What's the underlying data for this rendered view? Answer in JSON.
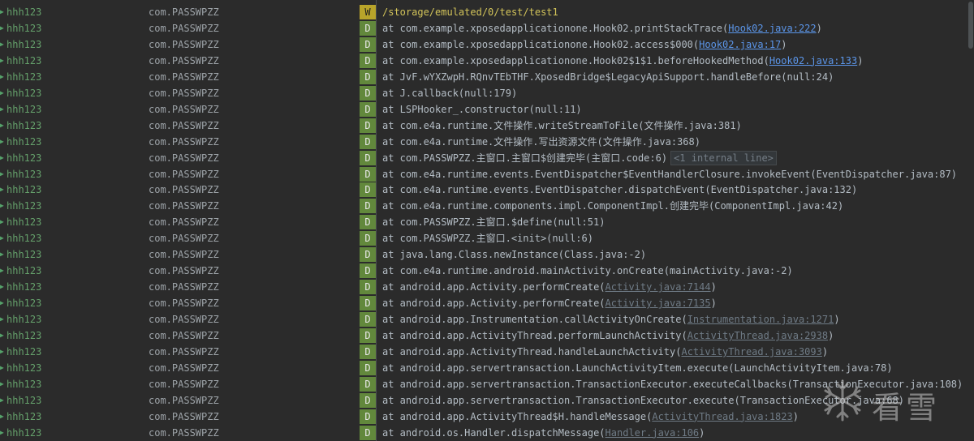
{
  "logcat": {
    "rows": [
      {
        "tag": "hhh123",
        "pkg": "com.PASSWPZZ",
        "level": "W",
        "parts": [
          {
            "t": "/storage/emulated/0/test/test1"
          }
        ]
      },
      {
        "tag": "hhh123",
        "pkg": "com.PASSWPZZ",
        "level": "D",
        "parts": [
          {
            "t": "at com.example.xposedapplicationone.Hook02.printStackTrace("
          },
          {
            "t": "Hook02.java:222",
            "link": "blue"
          },
          {
            "t": ")"
          }
        ]
      },
      {
        "tag": "hhh123",
        "pkg": "com.PASSWPZZ",
        "level": "D",
        "parts": [
          {
            "t": "at com.example.xposedapplicationone.Hook02.access$000("
          },
          {
            "t": "Hook02.java:17",
            "link": "blue"
          },
          {
            "t": ")"
          }
        ]
      },
      {
        "tag": "hhh123",
        "pkg": "com.PASSWPZZ",
        "level": "D",
        "parts": [
          {
            "t": "at com.example.xposedapplicationone.Hook02$1$1.beforeHookedMethod("
          },
          {
            "t": "Hook02.java:133",
            "link": "blue"
          },
          {
            "t": ")"
          }
        ]
      },
      {
        "tag": "hhh123",
        "pkg": "com.PASSWPZZ",
        "level": "D",
        "parts": [
          {
            "t": "at JvF.wYXZwpH.RQnvTEbTHF.XposedBridge$LegacyApiSupport.handleBefore(null:24)"
          }
        ]
      },
      {
        "tag": "hhh123",
        "pkg": "com.PASSWPZZ",
        "level": "D",
        "parts": [
          {
            "t": "at J.callback(null:179)"
          }
        ]
      },
      {
        "tag": "hhh123",
        "pkg": "com.PASSWPZZ",
        "level": "D",
        "parts": [
          {
            "t": "at LSPHooker_.constructor(null:11)"
          }
        ]
      },
      {
        "tag": "hhh123",
        "pkg": "com.PASSWPZZ",
        "level": "D",
        "parts": [
          {
            "t": "at com.e4a.runtime.文件操作.writeStreamToFile(文件操作.java:381)"
          }
        ]
      },
      {
        "tag": "hhh123",
        "pkg": "com.PASSWPZZ",
        "level": "D",
        "parts": [
          {
            "t": "at com.e4a.runtime.文件操作.写出资源文件(文件操作.java:368)"
          }
        ]
      },
      {
        "tag": "hhh123",
        "pkg": "com.PASSWPZZ",
        "level": "D",
        "parts": [
          {
            "t": "at com.PASSWPZZ.主窗口.主窗口$创建完毕(主窗口.code:6)"
          },
          {
            "t": "<1 internal line>",
            "fold": true
          }
        ]
      },
      {
        "tag": "hhh123",
        "pkg": "com.PASSWPZZ",
        "level": "D",
        "parts": [
          {
            "t": "at com.e4a.runtime.events.EventDispatcher$EventHandlerClosure.invokeEvent(EventDispatcher.java:87)"
          }
        ]
      },
      {
        "tag": "hhh123",
        "pkg": "com.PASSWPZZ",
        "level": "D",
        "parts": [
          {
            "t": "at com.e4a.runtime.events.EventDispatcher.dispatchEvent(EventDispatcher.java:132)"
          }
        ]
      },
      {
        "tag": "hhh123",
        "pkg": "com.PASSWPZZ",
        "level": "D",
        "parts": [
          {
            "t": "at com.e4a.runtime.components.impl.ComponentImpl.创建完毕(ComponentImpl.java:42)"
          }
        ]
      },
      {
        "tag": "hhh123",
        "pkg": "com.PASSWPZZ",
        "level": "D",
        "parts": [
          {
            "t": "at com.PASSWPZZ.主窗口.$define(null:51)"
          }
        ]
      },
      {
        "tag": "hhh123",
        "pkg": "com.PASSWPZZ",
        "level": "D",
        "parts": [
          {
            "t": "at com.PASSWPZZ.主窗口.<init>(null:6)"
          }
        ]
      },
      {
        "tag": "hhh123",
        "pkg": "com.PASSWPZZ",
        "level": "D",
        "parts": [
          {
            "t": "at java.lang.Class.newInstance(Class.java:-2)"
          }
        ]
      },
      {
        "tag": "hhh123",
        "pkg": "com.PASSWPZZ",
        "level": "D",
        "parts": [
          {
            "t": "at com.e4a.runtime.android.mainActivity.onCreate(mainActivity.java:-2)"
          }
        ]
      },
      {
        "tag": "hhh123",
        "pkg": "com.PASSWPZZ",
        "level": "D",
        "parts": [
          {
            "t": "at android.app.Activity.performCreate("
          },
          {
            "t": "Activity.java:7144",
            "link": "grey"
          },
          {
            "t": ")"
          }
        ]
      },
      {
        "tag": "hhh123",
        "pkg": "com.PASSWPZZ",
        "level": "D",
        "parts": [
          {
            "t": "at android.app.Activity.performCreate("
          },
          {
            "t": "Activity.java:7135",
            "link": "grey"
          },
          {
            "t": ")"
          }
        ]
      },
      {
        "tag": "hhh123",
        "pkg": "com.PASSWPZZ",
        "level": "D",
        "parts": [
          {
            "t": "at android.app.Instrumentation.callActivityOnCreate("
          },
          {
            "t": "Instrumentation.java:1271",
            "link": "grey"
          },
          {
            "t": ")"
          }
        ]
      },
      {
        "tag": "hhh123",
        "pkg": "com.PASSWPZZ",
        "level": "D",
        "parts": [
          {
            "t": "at android.app.ActivityThread.performLaunchActivity("
          },
          {
            "t": "ActivityThread.java:2938",
            "link": "grey"
          },
          {
            "t": ")"
          }
        ]
      },
      {
        "tag": "hhh123",
        "pkg": "com.PASSWPZZ",
        "level": "D",
        "parts": [
          {
            "t": "at android.app.ActivityThread.handleLaunchActivity("
          },
          {
            "t": "ActivityThread.java:3093",
            "link": "grey"
          },
          {
            "t": ")"
          }
        ]
      },
      {
        "tag": "hhh123",
        "pkg": "com.PASSWPZZ",
        "level": "D",
        "parts": [
          {
            "t": "at android.app.servertransaction.LaunchActivityItem.execute(LaunchActivityItem.java:78)"
          }
        ]
      },
      {
        "tag": "hhh123",
        "pkg": "com.PASSWPZZ",
        "level": "D",
        "parts": [
          {
            "t": "at android.app.servertransaction.TransactionExecutor.executeCallbacks(TransactionExecutor.java:108)"
          }
        ]
      },
      {
        "tag": "hhh123",
        "pkg": "com.PASSWPZZ",
        "level": "D",
        "parts": [
          {
            "t": "at android.app.servertransaction.TransactionExecutor.execute(TransactionExecutor.java:68)"
          }
        ]
      },
      {
        "tag": "hhh123",
        "pkg": "com.PASSWPZZ",
        "level": "D",
        "parts": [
          {
            "t": "at android.app.ActivityThread$H.handleMessage("
          },
          {
            "t": "ActivityThread.java:1823",
            "link": "grey"
          },
          {
            "t": ")"
          }
        ]
      },
      {
        "tag": "hhh123",
        "pkg": "com.PASSWPZZ",
        "level": "D",
        "parts": [
          {
            "t": "at android.os.Handler.dispatchMessage("
          },
          {
            "t": "Handler.java:106",
            "link": "grey"
          },
          {
            "t": ")"
          }
        ]
      }
    ]
  },
  "watermark": {
    "text": "看雪",
    "icon": "kanxue-snowflake-icon"
  }
}
